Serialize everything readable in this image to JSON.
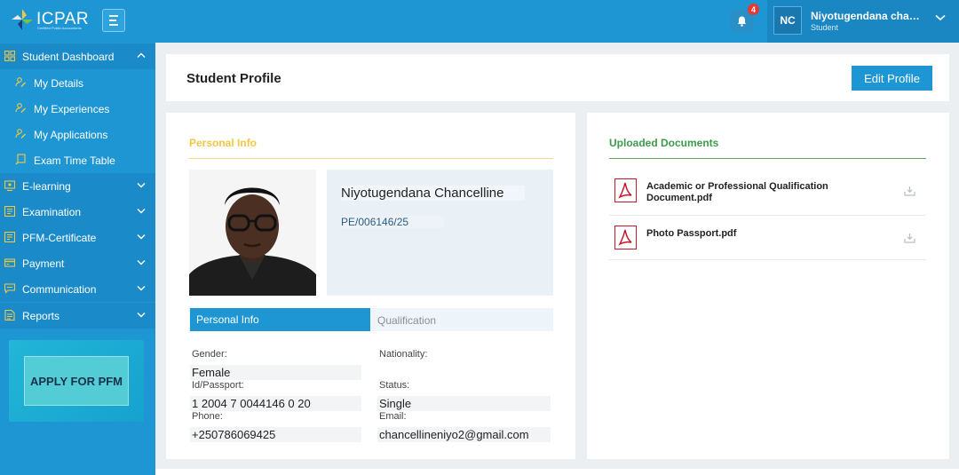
{
  "brand": {
    "name": "ICPAR",
    "tagline": "Certified Public Accountants"
  },
  "notifications": {
    "count": "4"
  },
  "user": {
    "initials": "NC",
    "name": "Niyotugendana chanc...",
    "role": "Student"
  },
  "sidebar": {
    "items": [
      {
        "label": "Student Dashboard",
        "icon": "grid-icon",
        "expanded": true
      },
      {
        "label": "E-learning",
        "icon": "elearning-icon"
      },
      {
        "label": "Examination",
        "icon": "list-icon"
      },
      {
        "label": "PFM-Certificate",
        "icon": "certificate-icon"
      },
      {
        "label": "Payment",
        "icon": "card-icon"
      },
      {
        "label": "Communication",
        "icon": "chat-icon"
      },
      {
        "label": "Reports",
        "icon": "report-icon"
      }
    ],
    "subitems": [
      {
        "label": "My Details"
      },
      {
        "label": "My Experiences"
      },
      {
        "label": "My Applications"
      },
      {
        "label": "Exam Time Table"
      }
    ],
    "apply_button": "APPLY FOR PFM"
  },
  "header": {
    "title": "Student Profile",
    "edit_button": "Edit Profile"
  },
  "profile": {
    "section_title": "Personal Info",
    "full_name": "Niyotugendana Chancelline",
    "reg_no": "PE/006146/25",
    "tabs": [
      "Personal Info",
      "Qualification"
    ],
    "fields": {
      "gender": {
        "label": "Gender:",
        "value": "Female"
      },
      "nationality": {
        "label": "Nationality:",
        "value": ""
      },
      "id_passport": {
        "label": "Id/Passport:",
        "value": "1 2004 7 0044146 0 20"
      },
      "status": {
        "label": "Status:",
        "value": "Single"
      },
      "phone": {
        "label": "Phone:",
        "value": "+250786069425"
      },
      "email": {
        "label": "Email:",
        "value": "chancellineniyo2@gmail.com"
      }
    }
  },
  "documents": {
    "section_title": "Uploaded Documents",
    "files": [
      {
        "name_line1": "Academic or Professional Qualification",
        "name_line2": "Document.pdf"
      },
      {
        "name_line1": "Photo Passport.pdf",
        "name_line2": ""
      }
    ]
  },
  "colors": {
    "primary": "#1e96d4",
    "accent_yellow": "#f2c744",
    "accent_green": "#3d9a4a",
    "pdf_red": "#c7172a"
  }
}
